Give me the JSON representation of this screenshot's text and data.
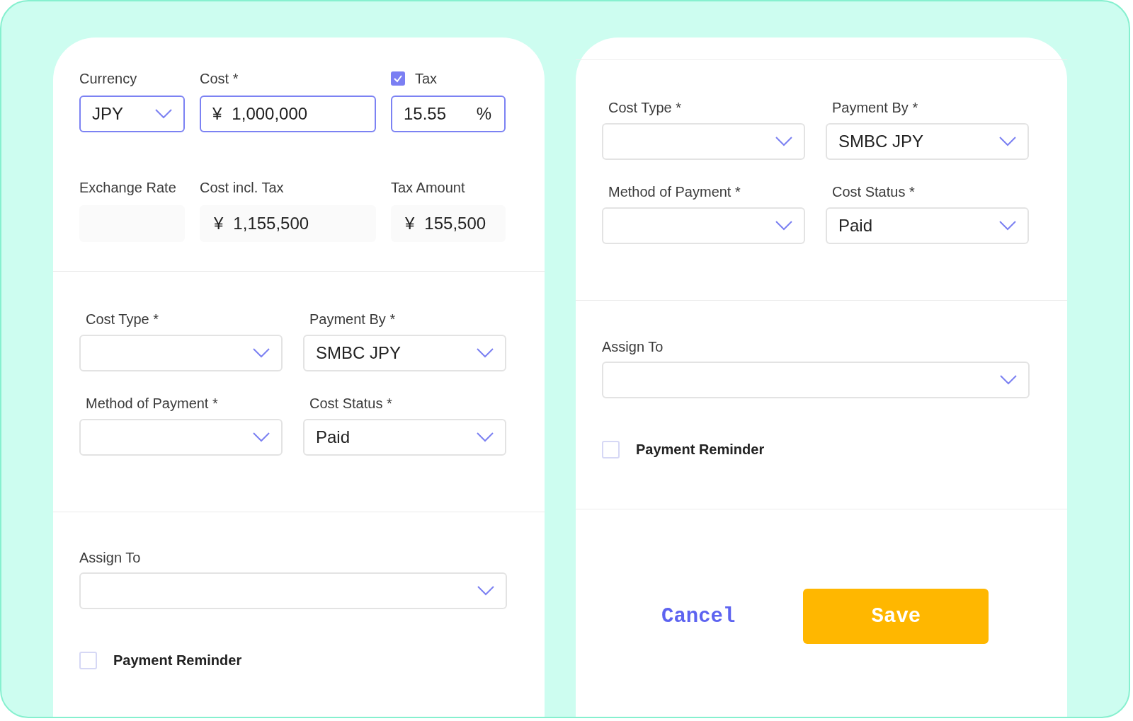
{
  "left_panel": {
    "amounts": [
      {
        "kind": "select",
        "label": "Currency",
        "value": "JPY",
        "focused": true
      },
      {
        "kind": "input",
        "label": "Cost *",
        "prefix": "¥",
        "value": "1,000,000",
        "focused": true
      },
      {
        "kind": "input",
        "label": "Tax",
        "checked": true,
        "value": "15.55",
        "suffix": "%",
        "focused": true
      },
      {
        "kind": "readonly",
        "label": "Exchange Rate"
      },
      {
        "kind": "readonly",
        "label": "Cost incl. Tax",
        "prefix": "¥",
        "value": "1,155,500"
      },
      {
        "kind": "readonly",
        "label": "Tax Amount",
        "prefix": "¥",
        "value": "155,500"
      }
    ],
    "details": [
      {
        "kind": "select",
        "label": "Cost Type *"
      },
      {
        "kind": "select",
        "label": "Payment By *",
        "value": "SMBC JPY"
      },
      {
        "kind": "select",
        "label": "Method of Payment *"
      },
      {
        "kind": "select",
        "label": "Cost Status *",
        "value": "Paid"
      }
    ],
    "assign": {
      "label": "Assign To"
    },
    "reminder": {
      "label": "Payment Reminder",
      "checked": false
    }
  },
  "right_panel": {
    "details": [
      {
        "kind": "select",
        "label": "Cost Type *"
      },
      {
        "kind": "select",
        "label": "Payment By *",
        "value": "SMBC JPY"
      },
      {
        "kind": "select",
        "label": "Method of Payment *"
      },
      {
        "kind": "select",
        "label": "Cost Status *",
        "value": "Paid"
      }
    ],
    "assign": {
      "label": "Assign To"
    },
    "reminder": {
      "label": "Payment Reminder",
      "checked": false
    },
    "buttons": [
      {
        "kind": "link",
        "label": "Cancel"
      },
      {
        "kind": "primary",
        "label": "Save"
      }
    ]
  }
}
